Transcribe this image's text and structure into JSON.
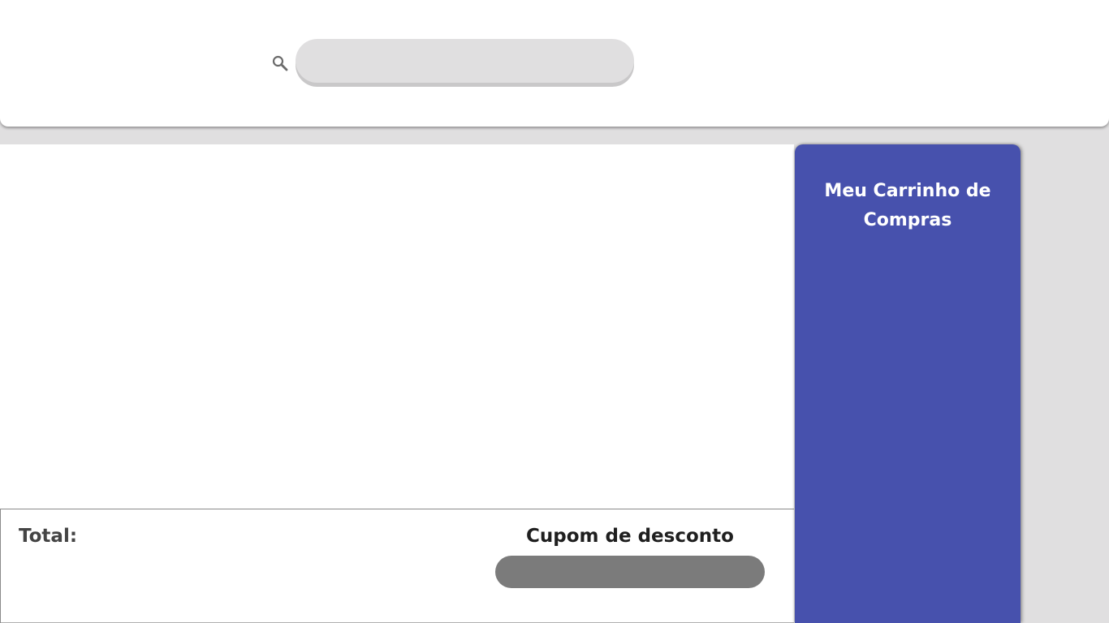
{
  "header": {
    "search": {
      "icon": "search-icon",
      "placeholder": "",
      "value": ""
    }
  },
  "footer": {
    "total_label": "Total:",
    "coupon_title": "Cupom de desconto",
    "coupon_placeholder": ""
  },
  "cart": {
    "title": "Meu Carrinho de Compras"
  },
  "colors": {
    "cart_background": "#4751ad",
    "page_background": "#e0dfe0",
    "search_background": "#e0dfe0",
    "coupon_background": "#7b7b7b"
  }
}
